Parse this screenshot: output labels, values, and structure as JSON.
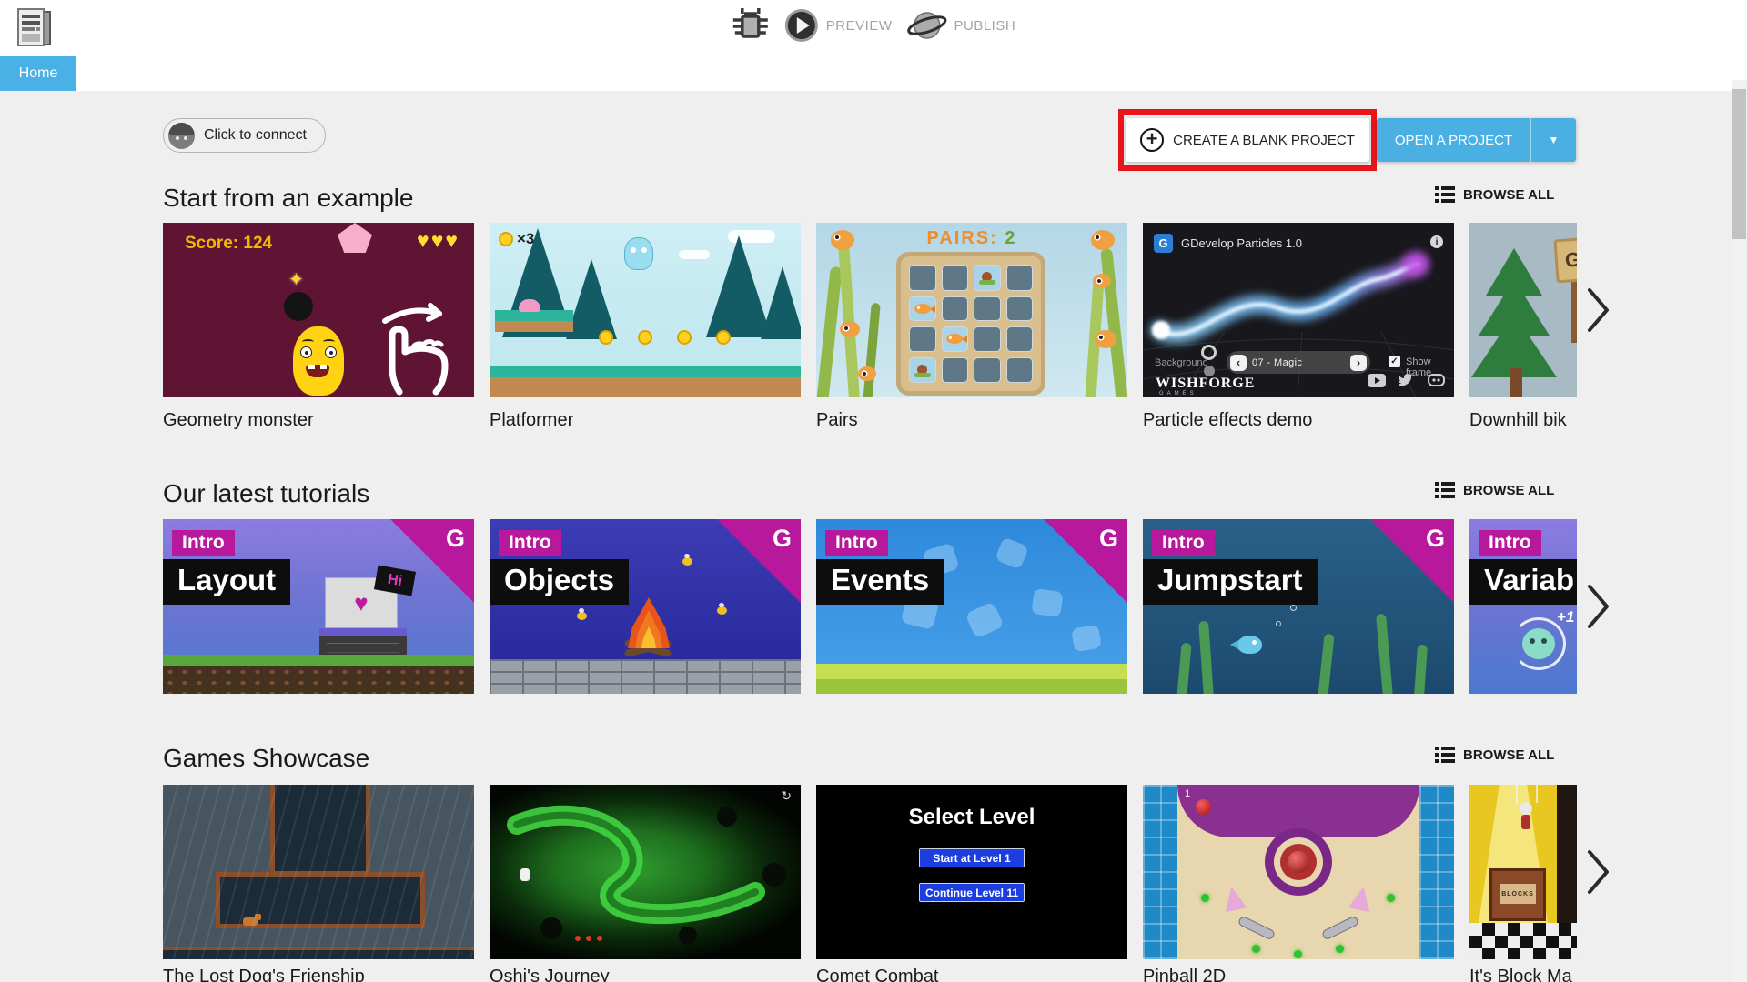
{
  "icons": {
    "dropdown": "▼",
    "plus": "+",
    "check": "✓",
    "prev": "‹",
    "next": "›",
    "info": "i",
    "heart": "♥",
    "hearts": "♥♥♥",
    "spark": "✦",
    "refresh": "↻"
  },
  "header": {
    "home": "Home",
    "preview": "PREVIEW",
    "publish": "PUBLISH"
  },
  "actions": {
    "connect": "Click to connect",
    "create": "CREATE A BLANK PROJECT",
    "open": "OPEN A PROJECT"
  },
  "sections": [
    {
      "title": "Start from an example",
      "browse": "BROWSE ALL"
    },
    {
      "title": "Our latest tutorials",
      "browse": "BROWSE ALL"
    },
    {
      "title": "Games Showcase",
      "browse": "BROWSE ALL"
    }
  ],
  "examples": [
    {
      "title": "Geometry monster",
      "score": "Score: 124"
    },
    {
      "title": "Platformer",
      "count": "×3"
    },
    {
      "title": "Pairs",
      "label": "PAIRS:",
      "value": "2"
    },
    {
      "title": "Particle effects demo",
      "app": "GDevelop Particles 1.0",
      "logo": "G",
      "background": "Background",
      "selector": "07 - Magic",
      "show_frame": "Show frame",
      "brand": "WISHFORGE",
      "brand_sub": "GAMES"
    },
    {
      "title": "Downhill bik",
      "sign": "G"
    }
  ],
  "tutorials": {
    "logo": "G",
    "items": [
      {
        "badge": "Intro",
        "name": "Layout",
        "extra": "Hi"
      },
      {
        "badge": "Intro",
        "name": "Objects"
      },
      {
        "badge": "Intro",
        "name": "Events"
      },
      {
        "badge": "Intro",
        "name": "Jumpstart"
      },
      {
        "badge": "Intro",
        "name": "Variab",
        "extra": "+1"
      }
    ]
  },
  "showcase": [
    {
      "title": "The Lost Dog's Frienship"
    },
    {
      "title": "Oshi's Journey"
    },
    {
      "title": "Comet Combat",
      "screen_title": "Select Level",
      "btn1": "Start at Level 1",
      "btn2": "Continue Level 11"
    },
    {
      "title": "Pinball 2D",
      "score": "1"
    },
    {
      "title": "It's Block Ma",
      "crate": "BLOCKS"
    }
  ],
  "colors": {
    "accent_blue": "#4ab0e3",
    "highlight_red": "#e9151b",
    "background": "#efefef"
  }
}
